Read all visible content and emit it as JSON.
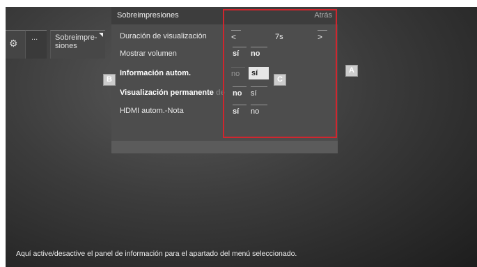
{
  "left_menu": {
    "dots_label": "...",
    "overlay_label": "Sobreimpre-\nsiones"
  },
  "panel": {
    "title": "Sobreimpresiones",
    "back_label": "Atrás",
    "rows": [
      {
        "label": "Duración de visualizaciòn",
        "prev": "<",
        "value": "7s",
        "next": ">"
      },
      {
        "label": "Mostrar volumen",
        "opt1": "sí",
        "opt2": "no"
      },
      {
        "label": "Información autom.",
        "opt1": "no",
        "opt2": "sí"
      },
      {
        "label_main": "Visualización permanente ",
        "label_faded": "de",
        "opt1": "no",
        "opt2": "sí"
      },
      {
        "label": "HDMI autom.-Nota",
        "opt1": "sí",
        "opt2": "no"
      }
    ]
  },
  "callouts": {
    "a": "A",
    "b": "B",
    "c": "C"
  },
  "help_text": "Aquí active/desactive el panel de información para el apartado del menú seleccionado.",
  "colors": {
    "highlight": "#d0262e",
    "selected": "#e6e6e6"
  }
}
